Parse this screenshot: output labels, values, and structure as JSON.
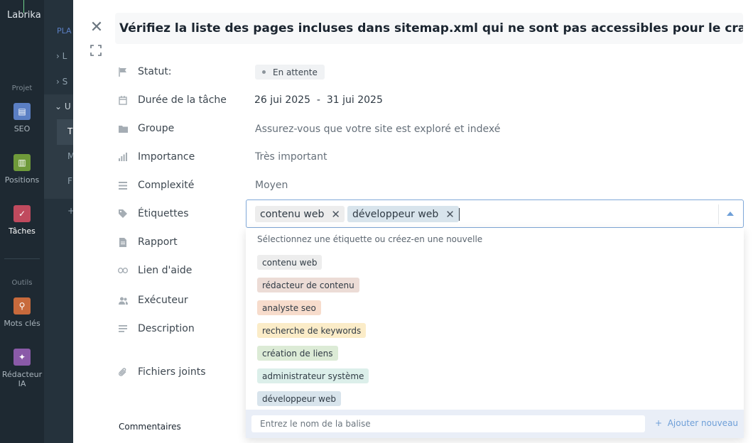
{
  "app": {
    "logo": "Labrika"
  },
  "rail": {
    "section_project": "Projet",
    "section_tools": "Outils",
    "items": [
      {
        "label": "SEO",
        "icon": "clipboard-icon",
        "color": "#5b7fc4"
      },
      {
        "label": "Positions",
        "icon": "chart-icon",
        "color": "#6f9a3a"
      },
      {
        "label": "Tâches",
        "icon": "check-icon",
        "color": "#c04a5e"
      },
      {
        "label": "Mots clés",
        "icon": "key-icon",
        "color": "#c86a3c"
      },
      {
        "label": "Rédacteur IA",
        "icon": "magic-wand-icon",
        "color": "#8a5aa8"
      }
    ]
  },
  "sub_sidebar": {
    "heading": "PLA",
    "rows": [
      "L",
      "S",
      "U",
      "T",
      "M",
      "F",
      "+"
    ]
  },
  "task": {
    "title": "Vérifiez la liste des pages incluses dans sitemap.xml qui ne sont pas accessibles pour le crawl",
    "fields": {
      "status_label": "Statut:",
      "status_value": "En attente",
      "duration_label": "Durée de la tâche",
      "duration_start": "26 jui 2025",
      "duration_sep": "-",
      "duration_end": "31 jui 2025",
      "group_label": "Groupe",
      "group_value": "Assurez-vous que votre site est exploré et indexé",
      "importance_label": "Importance",
      "importance_value": "Très important",
      "complexity_label": "Complexité",
      "complexity_value": "Moyen",
      "tags_label": "Étiquettes",
      "report_label": "Rapport",
      "help_link_label": "Lien d'aide",
      "executor_label": "Exécuteur",
      "description_label": "Description",
      "attachments_label": "Fichiers joints"
    },
    "comments_label": "Commentaires"
  },
  "tags": {
    "selected": [
      {
        "label": "contenu web",
        "color": "#ededed"
      },
      {
        "label": "développeur web",
        "color": "#d8e4ec"
      }
    ],
    "dropdown_hint": "Sélectionnez une étiquette ou créez-en une nouvelle",
    "options": [
      {
        "label": "contenu web",
        "color": "#ededed"
      },
      {
        "label": "rédacteur de contenu",
        "color": "#ecdcd6"
      },
      {
        "label": "analyste seo",
        "color": "#f7dccc"
      },
      {
        "label": "recherche de keywords",
        "color": "#fbecc8"
      },
      {
        "label": "création de liens",
        "color": "#dcebd6"
      },
      {
        "label": "administrateur système",
        "color": "#dcefea"
      },
      {
        "label": "développeur web",
        "color": "#d8e4ec"
      }
    ],
    "new_tag_placeholder": "Entrez le nom de la balise",
    "add_new_label": "Ajouter nouveau",
    "add_new_prefix": "+"
  }
}
